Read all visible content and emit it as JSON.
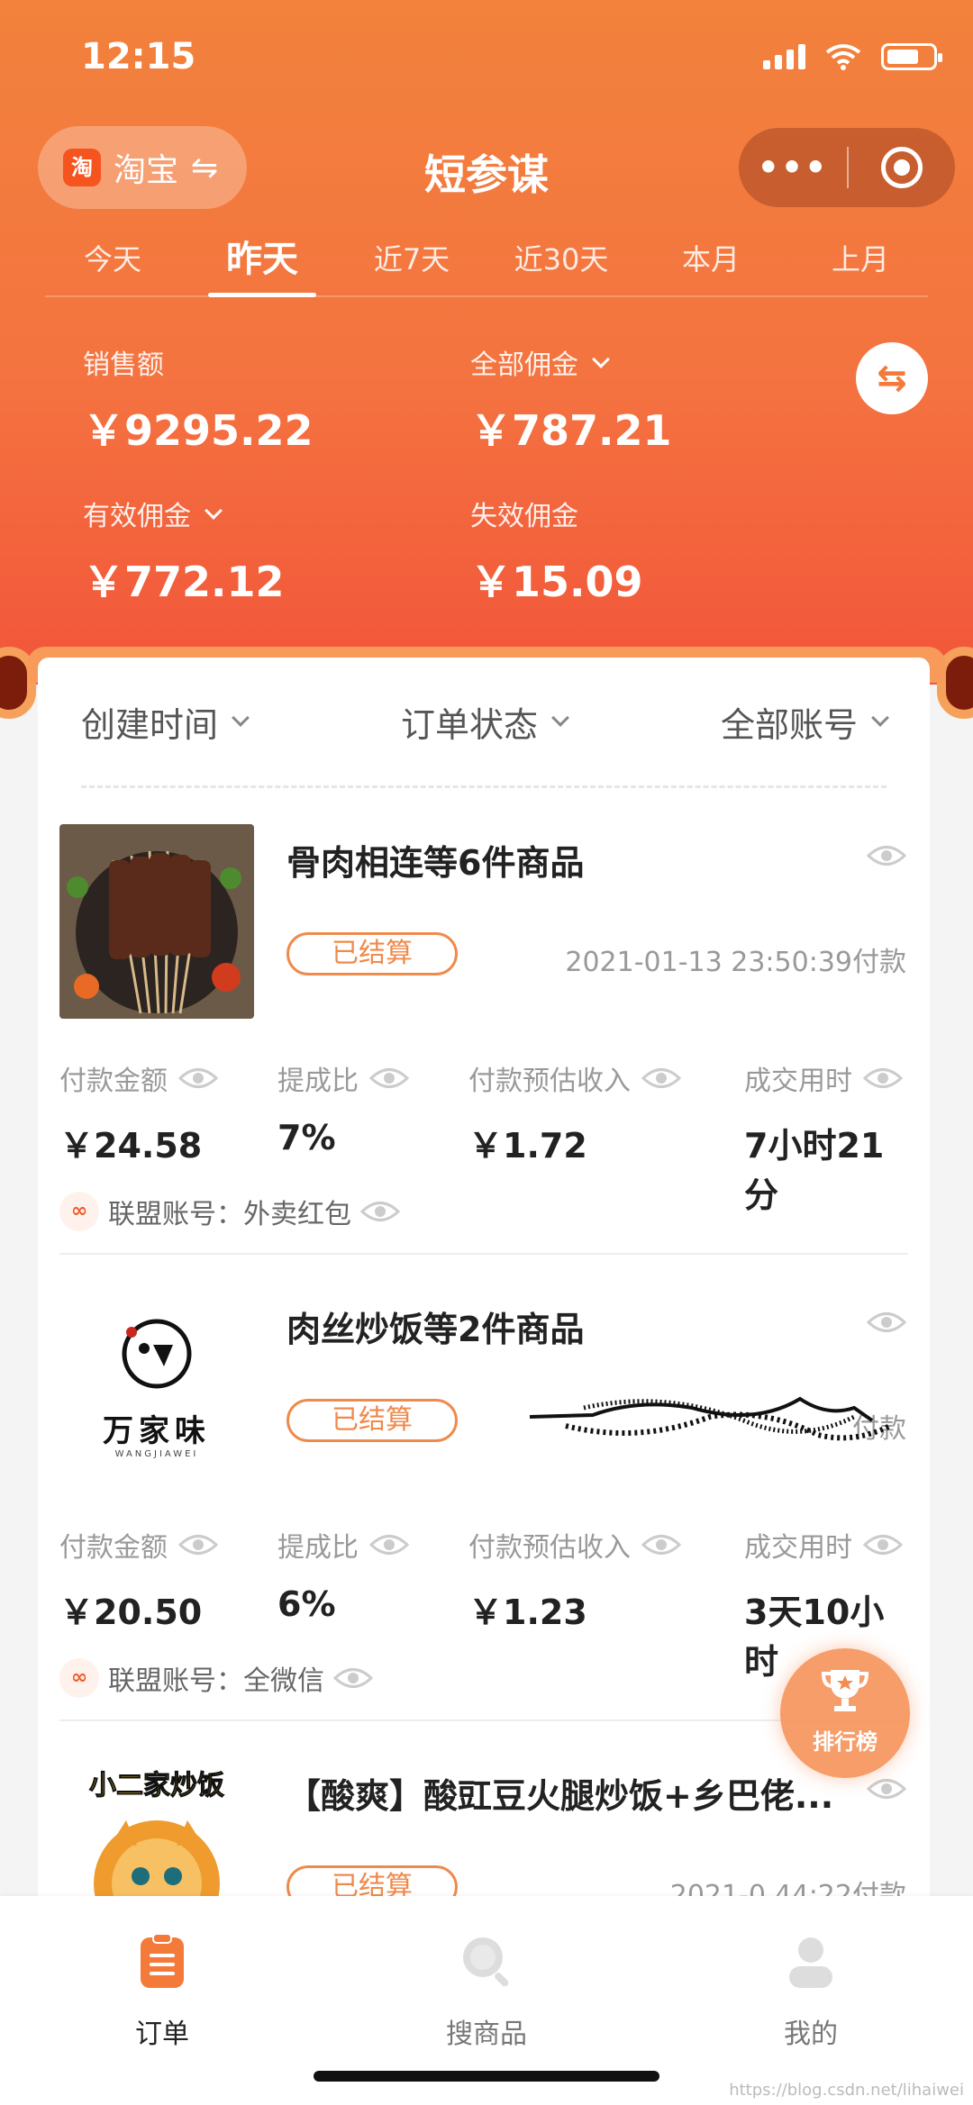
{
  "status": {
    "time": "12:15"
  },
  "header": {
    "platform": {
      "logo": "淘",
      "name": "淘宝",
      "switch_icon": "⇋"
    },
    "title": "短参谋",
    "capsule": {
      "more": "•••"
    }
  },
  "tabs": [
    {
      "label": "今天"
    },
    {
      "label": "昨天"
    },
    {
      "label": "近7天"
    },
    {
      "label": "近30天"
    },
    {
      "label": "本月"
    },
    {
      "label": "上月"
    }
  ],
  "active_tab": "昨天",
  "stats": {
    "sales": {
      "label": "销售额",
      "value": "￥9295.22"
    },
    "total_commission": {
      "label": "全部佣金",
      "value": "￥787.21"
    },
    "valid_commission": {
      "label": "有效佣金",
      "value": "￥772.12"
    },
    "invalid_commission": {
      "label": "失效佣金",
      "value": "￥15.09"
    },
    "swap_icon": "⇆"
  },
  "filters": [
    {
      "label": "创建时间"
    },
    {
      "label": "订单状态"
    },
    {
      "label": "全部账号"
    }
  ],
  "orders": [
    {
      "title": "骨肉相连等6件商品",
      "status": "已结算",
      "paytime": "2021-01-13 23:50:39付款",
      "metrics": [
        {
          "label": "付款金额",
          "value": "￥24.58"
        },
        {
          "label": "提成比",
          "value": "7%"
        },
        {
          "label": "付款预估收入",
          "value": "￥1.72"
        },
        {
          "label": "成交用时",
          "value": "7小时21分"
        }
      ],
      "account_label": "联盟账号：外卖红包"
    },
    {
      "title": "肉丝炒饭等2件商品",
      "status": "已结算",
      "paytime": "付款",
      "logo_text": "万家味",
      "logo_sub": "WANGJIAWEI",
      "metrics": [
        {
          "label": "付款金额",
          "value": "￥20.50"
        },
        {
          "label": "提成比",
          "value": "6%"
        },
        {
          "label": "付款预估收入",
          "value": "￥1.23"
        },
        {
          "label": "成交用时",
          "value": "3天10小时"
        }
      ],
      "account_label": "联盟账号：全微信"
    },
    {
      "title": "【酸爽】酸豇豆火腿炒饭+乡巴佬...",
      "status": "已结算",
      "paytime": "2021-0 44:22付款",
      "logo_text": "小二家炒饭"
    }
  ],
  "rank_button": {
    "label": "排行榜"
  },
  "tabbar": [
    {
      "label": "订单",
      "icon": "order-icon"
    },
    {
      "label": "搜商品",
      "icon": "search-icon"
    },
    {
      "label": "我的",
      "icon": "user-icon"
    }
  ],
  "watermark": "https://blog.csdn.net/lihaiwei",
  "colors": {
    "accent": "#f47a3a",
    "header_top": "#f2823c",
    "header_bottom": "#f2553a"
  }
}
